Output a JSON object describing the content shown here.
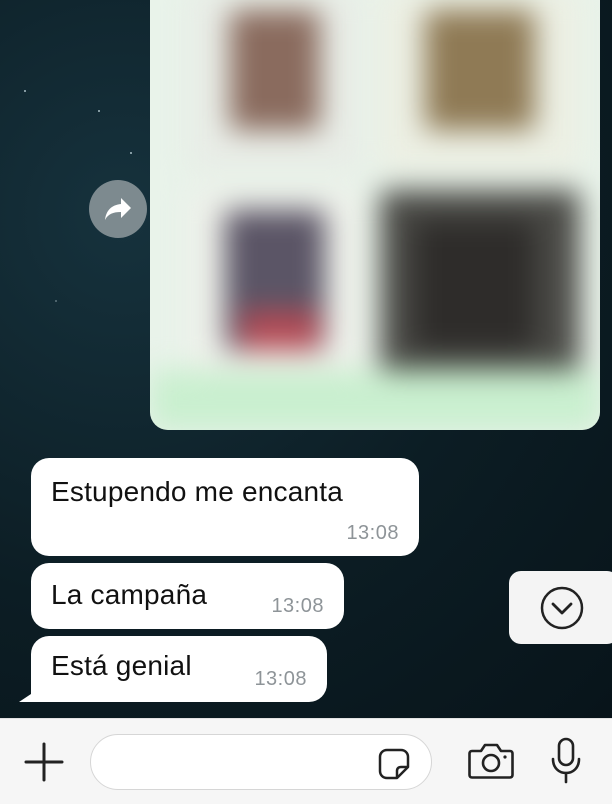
{
  "colors": {
    "chat_background": "#0d1b22",
    "bubble_background": "#ffffff",
    "timestamp": "#8e9498",
    "input_bar": "#f6f6f6",
    "icon": "#222222"
  },
  "image_message": {
    "icon": "forward-icon",
    "blurred": true
  },
  "messages": [
    {
      "text": "Estupendo me encanta",
      "time": "13:08"
    },
    {
      "text": "La campaña",
      "time": "13:08"
    },
    {
      "text": "Está genial",
      "time": "13:08"
    }
  ],
  "composer": {
    "input_value": "",
    "input_placeholder": "",
    "icons": {
      "attach": "plus-icon",
      "sticker": "sticker-icon",
      "camera": "camera-icon",
      "mic": "microphone-icon",
      "scroll": "chevron-down-icon"
    }
  }
}
